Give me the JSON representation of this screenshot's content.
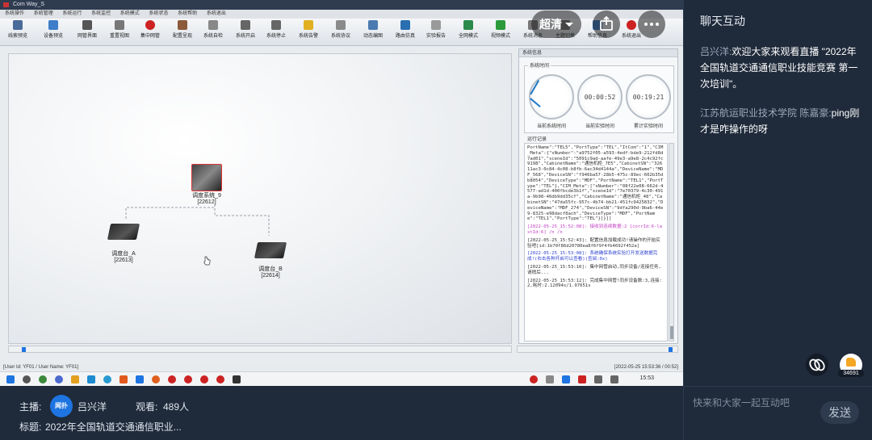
{
  "stream": {
    "window_title": "Com Way_S",
    "menu": [
      "系统操作",
      "系统管理",
      "系统运行",
      "系统监控",
      "系统模式",
      "系统状态",
      "系统帮助",
      "系统退出"
    ],
    "toolbar": [
      "线索预览",
      "设备预览",
      "网管界面",
      "重置视图",
      "集中网管",
      "配置呈现",
      "系统自检",
      "系统开启",
      "系统停止",
      "系统告警",
      "系统协议",
      "动态编图",
      "路由仿真",
      "实验报告",
      "全网模式",
      "视频模式",
      "系统消息",
      "主题切换",
      "帮助信息",
      "系统退出"
    ],
    "nodes": {
      "dispatch_system": {
        "name": "调度系统_9",
        "id": "[22612]"
      },
      "console_a": {
        "name": "调度台_A",
        "id": "[22613]"
      },
      "console_b": {
        "name": "调度台_B",
        "id": "[22614]"
      }
    },
    "sysinfo": {
      "panel_title": "系统信息",
      "time_group": "系统时间",
      "clocks": [
        {
          "label": "当前系统时间",
          "value": ""
        },
        {
          "label": "当前实验时间",
          "value": "00:00:52"
        },
        {
          "label": "累计实验时间",
          "value": "00:19:21"
        }
      ],
      "log_group": "运行记录",
      "log": [
        {
          "text": "PortName\":\"TEL5\",\"PortType\":\"TEL\",\"ItCom\":\"1\",\"CIM_Meta\":{\"sNumber\":\"a9752f05-a593-4edf-bde9-212fd8d7ad01\",\"sceneId\":\"5091c9ad-aafe-49e3-a9e8-2c4c92fc9198\",\"CabinetName\":\"通信机柜_7E5\",\"CabinetSN\":\"32611ac3-0c84-4c08-b8fb-6ac34d4144a\",\"DeviceName\":\"MDF_568\",\"DeviceSN\":\"f946ba57-28b5-475c-89ec-602b35db8054\",\"DeviceType\":\"MDF\",\"PortName\":\"TEL1\",\"PortType\":\"TEL\"},\"CIM_Meta\":[\"sNumber\":\"08f22e08-662d-4577-ad1d-400fbcde3b1f\",\"sceneId\":\"7e70379-4c30-491a-9b98-46db9dd35cf\",\"CabinetName\":\"通信机柜_48\",\"CabinetSN\":\"47da55fc-957c-4b74-bb21-451fc9425832\",\"DeviceName\":\"MDF_274\",\"DeviceSN\":\"9dfa290d-9ba6-44e9-8325-e98dacf8ach\",\"DeviceType\":\"MDF\",\"PortName\":\"TEL1\",\"PortType\":\"TEL\"}]}]]",
          "tone": "plain"
        },
        {
          "text": "[2022-05-25_15:52:08]: 接收到连续数据:2 [corrId:6-lastId:6] /n /n",
          "tone": "mag"
        },
        {
          "text": "[2022-05-25_15:52:43]: 配置信息加载成功!请操作的开始实验吧[id:1b70f86d20780ea8f6f9f4fb4692f452a]",
          "tone": "plain"
        },
        {
          "text": "[2022-05-25_15:53:08]: 系统确保系统实验打开发送数据完成!(右击各种开启可以查看)(查阅:0x)",
          "tone": "blu"
        },
        {
          "text": "[2022-05-25_15:53:10]: 集中网管启动,同步设备/连接任务,请稍后...",
          "tone": "plain"
        },
        {
          "text": "[2022-05-25_15:53:12]: 完成集中网管!同步设备数:3,连接:2,耗时:2.12094s/1.97651s",
          "tone": "plain"
        }
      ]
    },
    "statusbar": {
      "user": "[User Id: YF01 / User Name: YF01]",
      "time": "[2022-05-25 15:53:36 / 00:52]"
    },
    "taskbar_time": "15:53"
  },
  "overlay": {
    "quality": "超清"
  },
  "info": {
    "host_label": "主播:",
    "avatar_text": "闻扑",
    "host_name": "吕兴洋",
    "viewers_label": "观看:",
    "viewers": "489人",
    "title_label": "标题:",
    "title": "2022年全国轨道交通通信职业..."
  },
  "chat": {
    "title": "聊天互动",
    "messages": [
      {
        "user": "吕兴洋:",
        "text": "欢迎大家来观看直播 \"2022年全国轨道交通通信职业技能竞赛 第一次培训\"。"
      },
      {
        "user": "江苏航运职业技术学院 陈嘉豪:",
        "text": "ping刚才是咋操作的呀"
      }
    ],
    "like_count": "34691",
    "input_placeholder": "快来和大家一起互动吧",
    "send_label": "发送"
  },
  "colors": {
    "background": "#1f2a3a",
    "accent": "#1e74e0",
    "like": "#f5a623"
  }
}
